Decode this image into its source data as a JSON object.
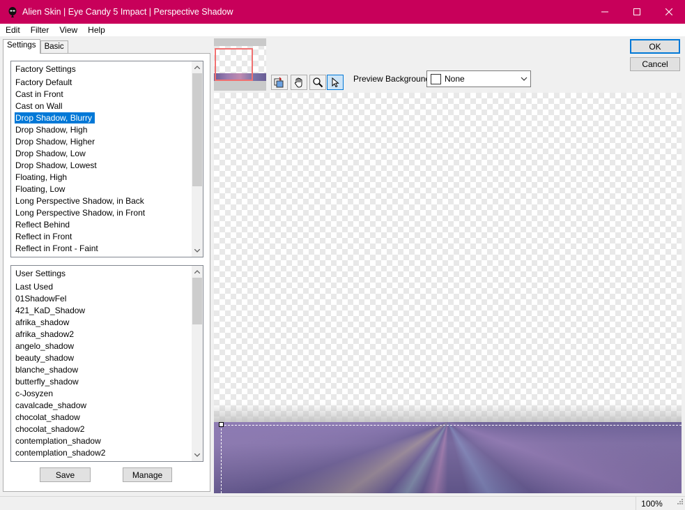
{
  "window": {
    "title": "Alien Skin | Eye Candy 5 Impact | Perspective Shadow",
    "controls": {
      "minimize": "—",
      "maximize": "☐",
      "close": "✕"
    }
  },
  "menu": [
    "Edit",
    "Filter",
    "View",
    "Help"
  ],
  "tabs": [
    {
      "label": "Settings",
      "active": true
    },
    {
      "label": "Basic",
      "active": false
    }
  ],
  "factory_settings": {
    "header": "Factory Settings",
    "items": [
      "Factory Default",
      "Cast in Front",
      "Cast on Wall",
      "Drop Shadow, Blurry",
      "Drop Shadow, High",
      "Drop Shadow, Higher",
      "Drop Shadow, Low",
      "Drop Shadow, Lowest",
      "Floating, High",
      "Floating, Low",
      "Long Perspective Shadow, in Back",
      "Long Perspective Shadow, in Front",
      "Reflect Behind",
      "Reflect in Front",
      "Reflect in Front - Faint"
    ],
    "selected": "Drop Shadow, Blurry"
  },
  "user_settings": {
    "header": "User Settings",
    "items": [
      "Last Used",
      "01ShadowFel",
      "421_KaD_Shadow",
      "afrika_shadow",
      "afrika_shadow2",
      "angelo_shadow",
      "beauty_shadow",
      "blanche_shadow",
      "butterfly_shadow",
      "c-Josyzen",
      "cavalcade_shadow",
      "chocolat_shadow",
      "chocolat_shadow2",
      "contemplation_shadow",
      "contemplation_shadow2"
    ]
  },
  "buttons": {
    "save": "Save",
    "manage": "Manage",
    "ok": "OK",
    "cancel": "Cancel"
  },
  "tools": [
    "navigator-pan-icon",
    "hand-icon",
    "zoom-icon",
    "pointer-icon"
  ],
  "preview_background": {
    "label": "Preview Background:",
    "value": "None"
  },
  "status": {
    "zoom": "100%"
  },
  "colors": {
    "titlebar": "#c8005a",
    "selection": "#0078d7",
    "navigator_frame": "#f07070"
  }
}
